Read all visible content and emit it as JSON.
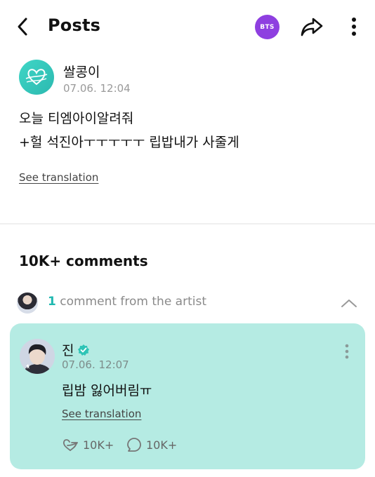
{
  "header": {
    "title": "Posts",
    "community_badge": "BTS",
    "icons": [
      "back-arrow-icon",
      "share-icon",
      "more-vertical-icon"
    ]
  },
  "post": {
    "author": "쌀콩이",
    "timestamp": "07.06. 12:04",
    "body_lines": [
      "오늘 티엠아이알려줘",
      "+헐 석진아ㅜㅜㅜㅜㅜ 립밥내가 사줄게"
    ],
    "translate_label": "See translation"
  },
  "comments": {
    "count_label": "10K+ comments",
    "artist_row": {
      "count": "1",
      "label": " comment from the artist"
    },
    "artist_comment": {
      "name": "진",
      "timestamp": "07.06. 12:07",
      "text": "립밤 잃어버림ㅠ",
      "translate_label": "See translation",
      "likes": "10K+",
      "replies": "10K+"
    }
  },
  "colors": {
    "accent_teal": "#1fb8b0",
    "card_bg": "#b5ebe3",
    "badge_purple": "#8e3fe0",
    "verified": "#2ec4b6"
  }
}
